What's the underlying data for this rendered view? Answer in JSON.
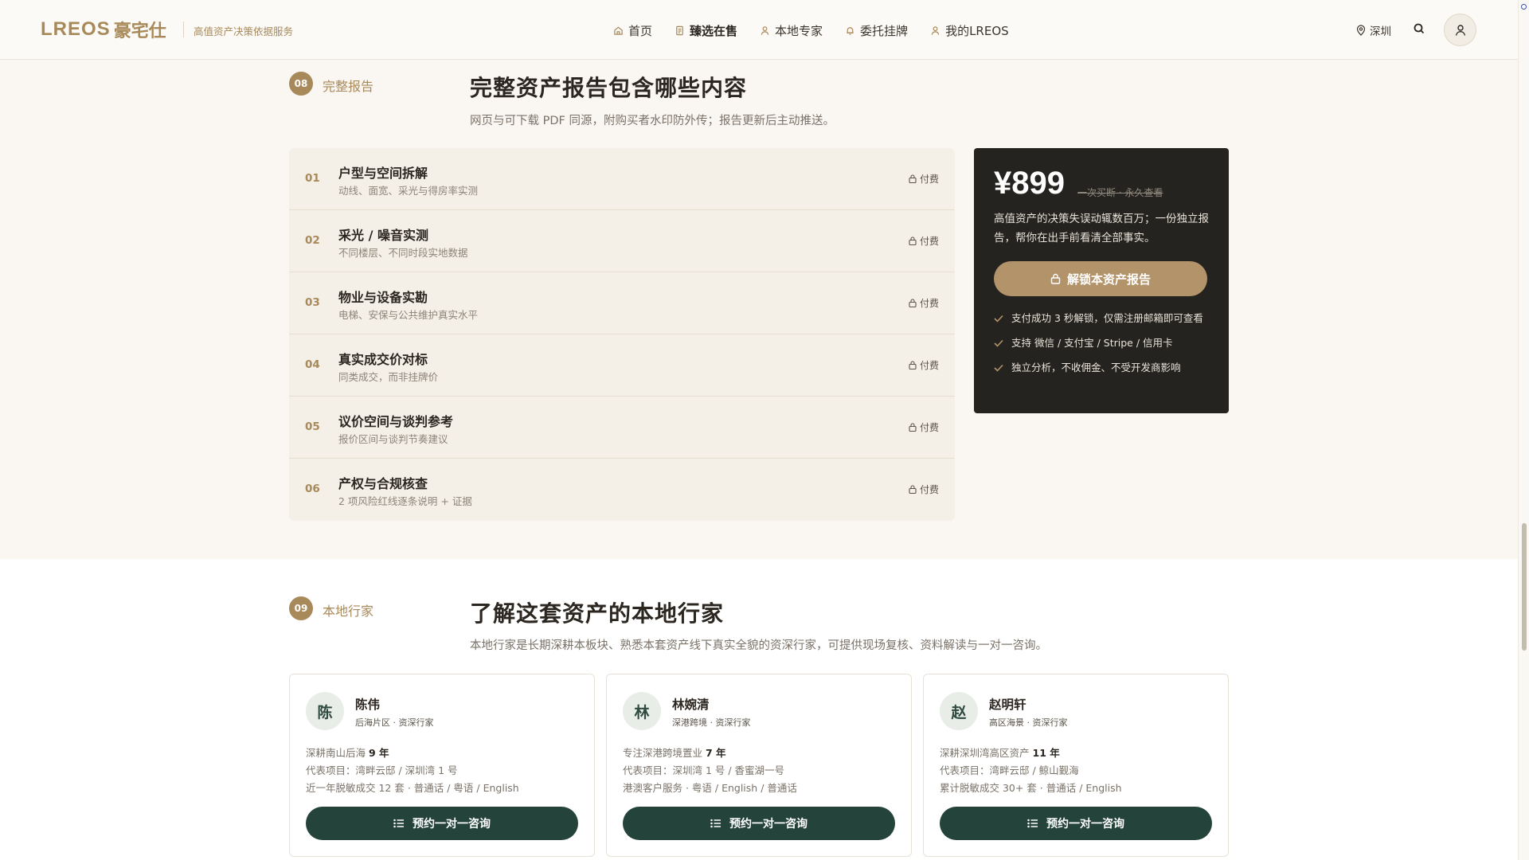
{
  "header": {
    "logo_latin": "LREOS",
    "logo_cn": "豪宅仕",
    "tagline": "高值资产决策依据服务",
    "nav": [
      {
        "label": "首页",
        "icon": "home-icon"
      },
      {
        "label": "臻选在售",
        "icon": "document-icon"
      },
      {
        "label": "本地专家",
        "icon": "person-icon"
      },
      {
        "label": "委托挂牌",
        "icon": "bell-icon"
      },
      {
        "label": "我的LREOS",
        "icon": "user-icon"
      }
    ],
    "active_nav": "臻选在售",
    "city": "深圳"
  },
  "section08": {
    "number": "08",
    "tag": "完整报告",
    "title": "完整资产报告包含哪些内容",
    "description": "网页与可下载 PDF 同源，附购买者水印防外传；报告更新后主动推送。",
    "items": [
      {
        "num": "01",
        "title": "户型与空间拆解",
        "subtitle": "动线、面宽、采光与得房率实测",
        "lock": "付费"
      },
      {
        "num": "02",
        "title": "采光 / 噪音实测",
        "subtitle": "不同楼层、不同时段实地数据",
        "lock": "付费"
      },
      {
        "num": "03",
        "title": "物业与设备实勘",
        "subtitle": "电梯、安保与公共维护真实水平",
        "lock": "付费"
      },
      {
        "num": "04",
        "title": "真实成交价对标",
        "subtitle": "同类成交，而非挂牌价",
        "lock": "付费"
      },
      {
        "num": "05",
        "title": "议价空间与谈判参考",
        "subtitle": "报价区间与谈判节奏建议",
        "lock": "付费"
      },
      {
        "num": "06",
        "title": "产权与合规核查",
        "subtitle": "2 项风险红线逐条说明 + 证据",
        "lock": "付费"
      }
    ],
    "pricing": {
      "price": "¥899",
      "note": "一次买断 · 永久查看",
      "description": "高值资产的决策失误动辄数百万；一份独立报告，帮你在出手前看清全部事实。",
      "cta": "解锁本资产报告",
      "perks": [
        "支付成功 3 秒解锁，仅需注册邮箱即可查看",
        "支持 微信 / 支付宝 / Stripe / 信用卡",
        "独立分析，不收佣金、不受开发商影响"
      ]
    }
  },
  "section09": {
    "number": "09",
    "tag": "本地行家",
    "title": "了解这套资产的本地行家",
    "description": "本地行家是长期深耕本板块、熟悉本套资产线下真实全貌的资深行家，可提供现场复核、资料解读与一对一咨询。",
    "experts": [
      {
        "initial": "陈",
        "name": "陈伟",
        "role": "后海片区 · 资深行家",
        "line1_prefix": "深耕南山后海",
        "line1_bold": "9 年",
        "line2": "代表项目：湾畔云邸 / 深圳湾 1 号",
        "line3": "近一年脱敏成交 12 套 · 普通话 / 粤语 / English",
        "cta": "预约一对一咨询"
      },
      {
        "initial": "林",
        "name": "林婉清",
        "role": "深港跨境 · 资深行家",
        "line1_prefix": "专注深港跨境置业",
        "line1_bold": "7 年",
        "line2": "代表项目：深圳湾 1 号 / 香蜜湖一号",
        "line3": "港澳客户服务 · 粤语 / English / 普通话",
        "cta": "预约一对一咨询"
      },
      {
        "initial": "赵",
        "name": "赵明轩",
        "role": "高区海景 · 资深行家",
        "line1_prefix": "深耕深圳湾高区资产",
        "line1_bold": "11 年",
        "line2": "代表项目：湾畔云邸 / 鲸山觐海",
        "line3": "累计脱敏成交 30+ 套 · 普通话 / English",
        "cta": "预约一对一咨询"
      }
    ]
  },
  "colors": {
    "accent_gold": "#a8895a",
    "dark_green": "#24433a",
    "card_dark": "#25231f",
    "page_bg": "#faf7f2"
  }
}
